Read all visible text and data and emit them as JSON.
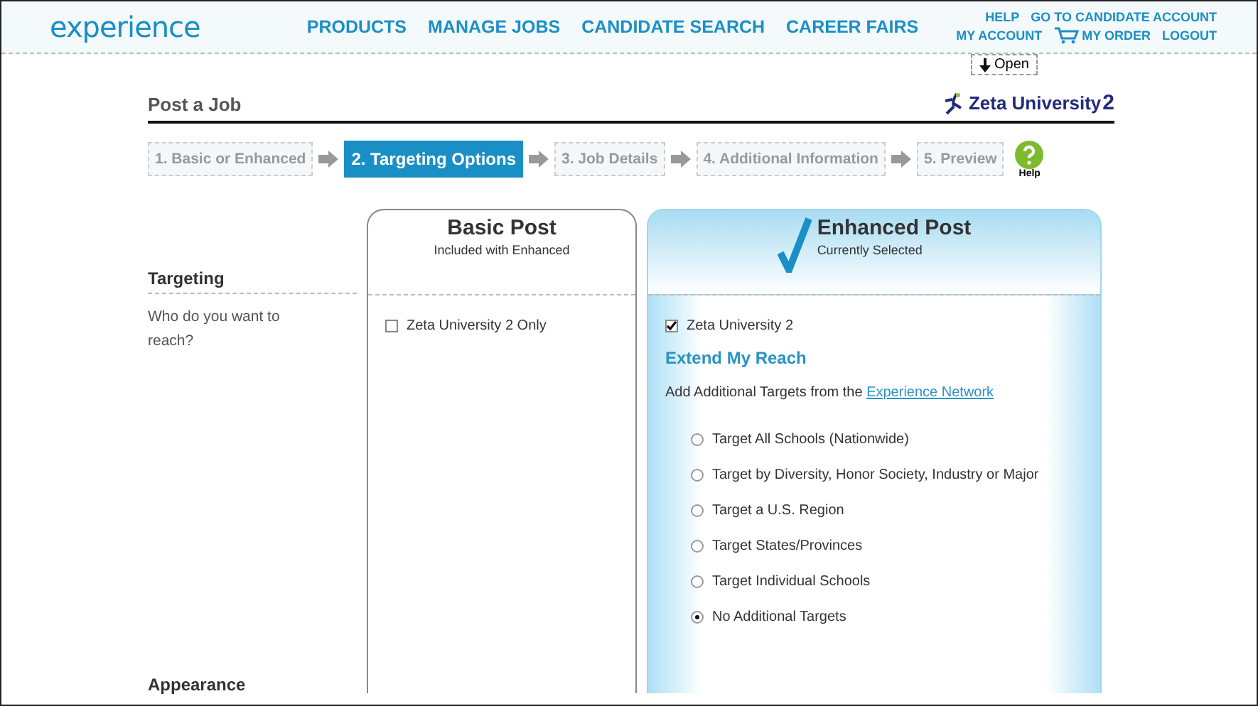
{
  "header": {
    "logo": "experience",
    "nav": [
      "PRODUCTS",
      "MANAGE JOBS",
      "CANDIDATE SEARCH",
      "CAREER FAIRS"
    ],
    "account_top": [
      "HELP",
      "GO TO CANDIDATE ACCOUNT"
    ],
    "account_bottom": [
      {
        "label": "MY ACCOUNT",
        "kind": "link"
      },
      {
        "label": "MY ORDER",
        "kind": "cart"
      },
      {
        "label": "LOGOUT",
        "kind": "link"
      }
    ],
    "open_button": "Open"
  },
  "page_title": "Post a Job",
  "brand": "Zeta University",
  "brand_suffix": "2",
  "steps": [
    {
      "label": "1. Basic or Enhanced",
      "selected": false
    },
    {
      "label": "2. Targeting Options",
      "selected": true
    },
    {
      "label": "3. Job Details",
      "selected": false
    },
    {
      "label": "4. Additional Information",
      "selected": false
    },
    {
      "label": "5. Preview",
      "selected": false
    }
  ],
  "help_label": "Help",
  "sections": {
    "targeting": "Targeting",
    "question": "Who do you want to reach?",
    "appearance": "Appearance"
  },
  "basic": {
    "title": "Basic Post",
    "subtitle": "Included with Enhanced",
    "option": {
      "label": "Zeta University 2 Only",
      "checked": false
    },
    "selected": false
  },
  "enhanced": {
    "title": "Enhanced Post",
    "subtitle": "Currently Selected",
    "option": {
      "label": "Zeta University 2",
      "checked": true
    },
    "selected": true,
    "extend_title": "Extend My Reach",
    "network_text": "Add Additional Targets from the ",
    "network_link": "Experience Network",
    "targets": [
      {
        "label": "Target All Schools (Nationwide)",
        "selected": false
      },
      {
        "label": "Target by Diversity, Honor Society, Industry or Major",
        "selected": false
      },
      {
        "label": "Target a U.S. Region",
        "selected": false
      },
      {
        "label": "Target States/Provinces",
        "selected": false
      },
      {
        "label": "Target Individual Schools",
        "selected": false
      },
      {
        "label": "No Additional Targets",
        "selected": true
      }
    ]
  }
}
